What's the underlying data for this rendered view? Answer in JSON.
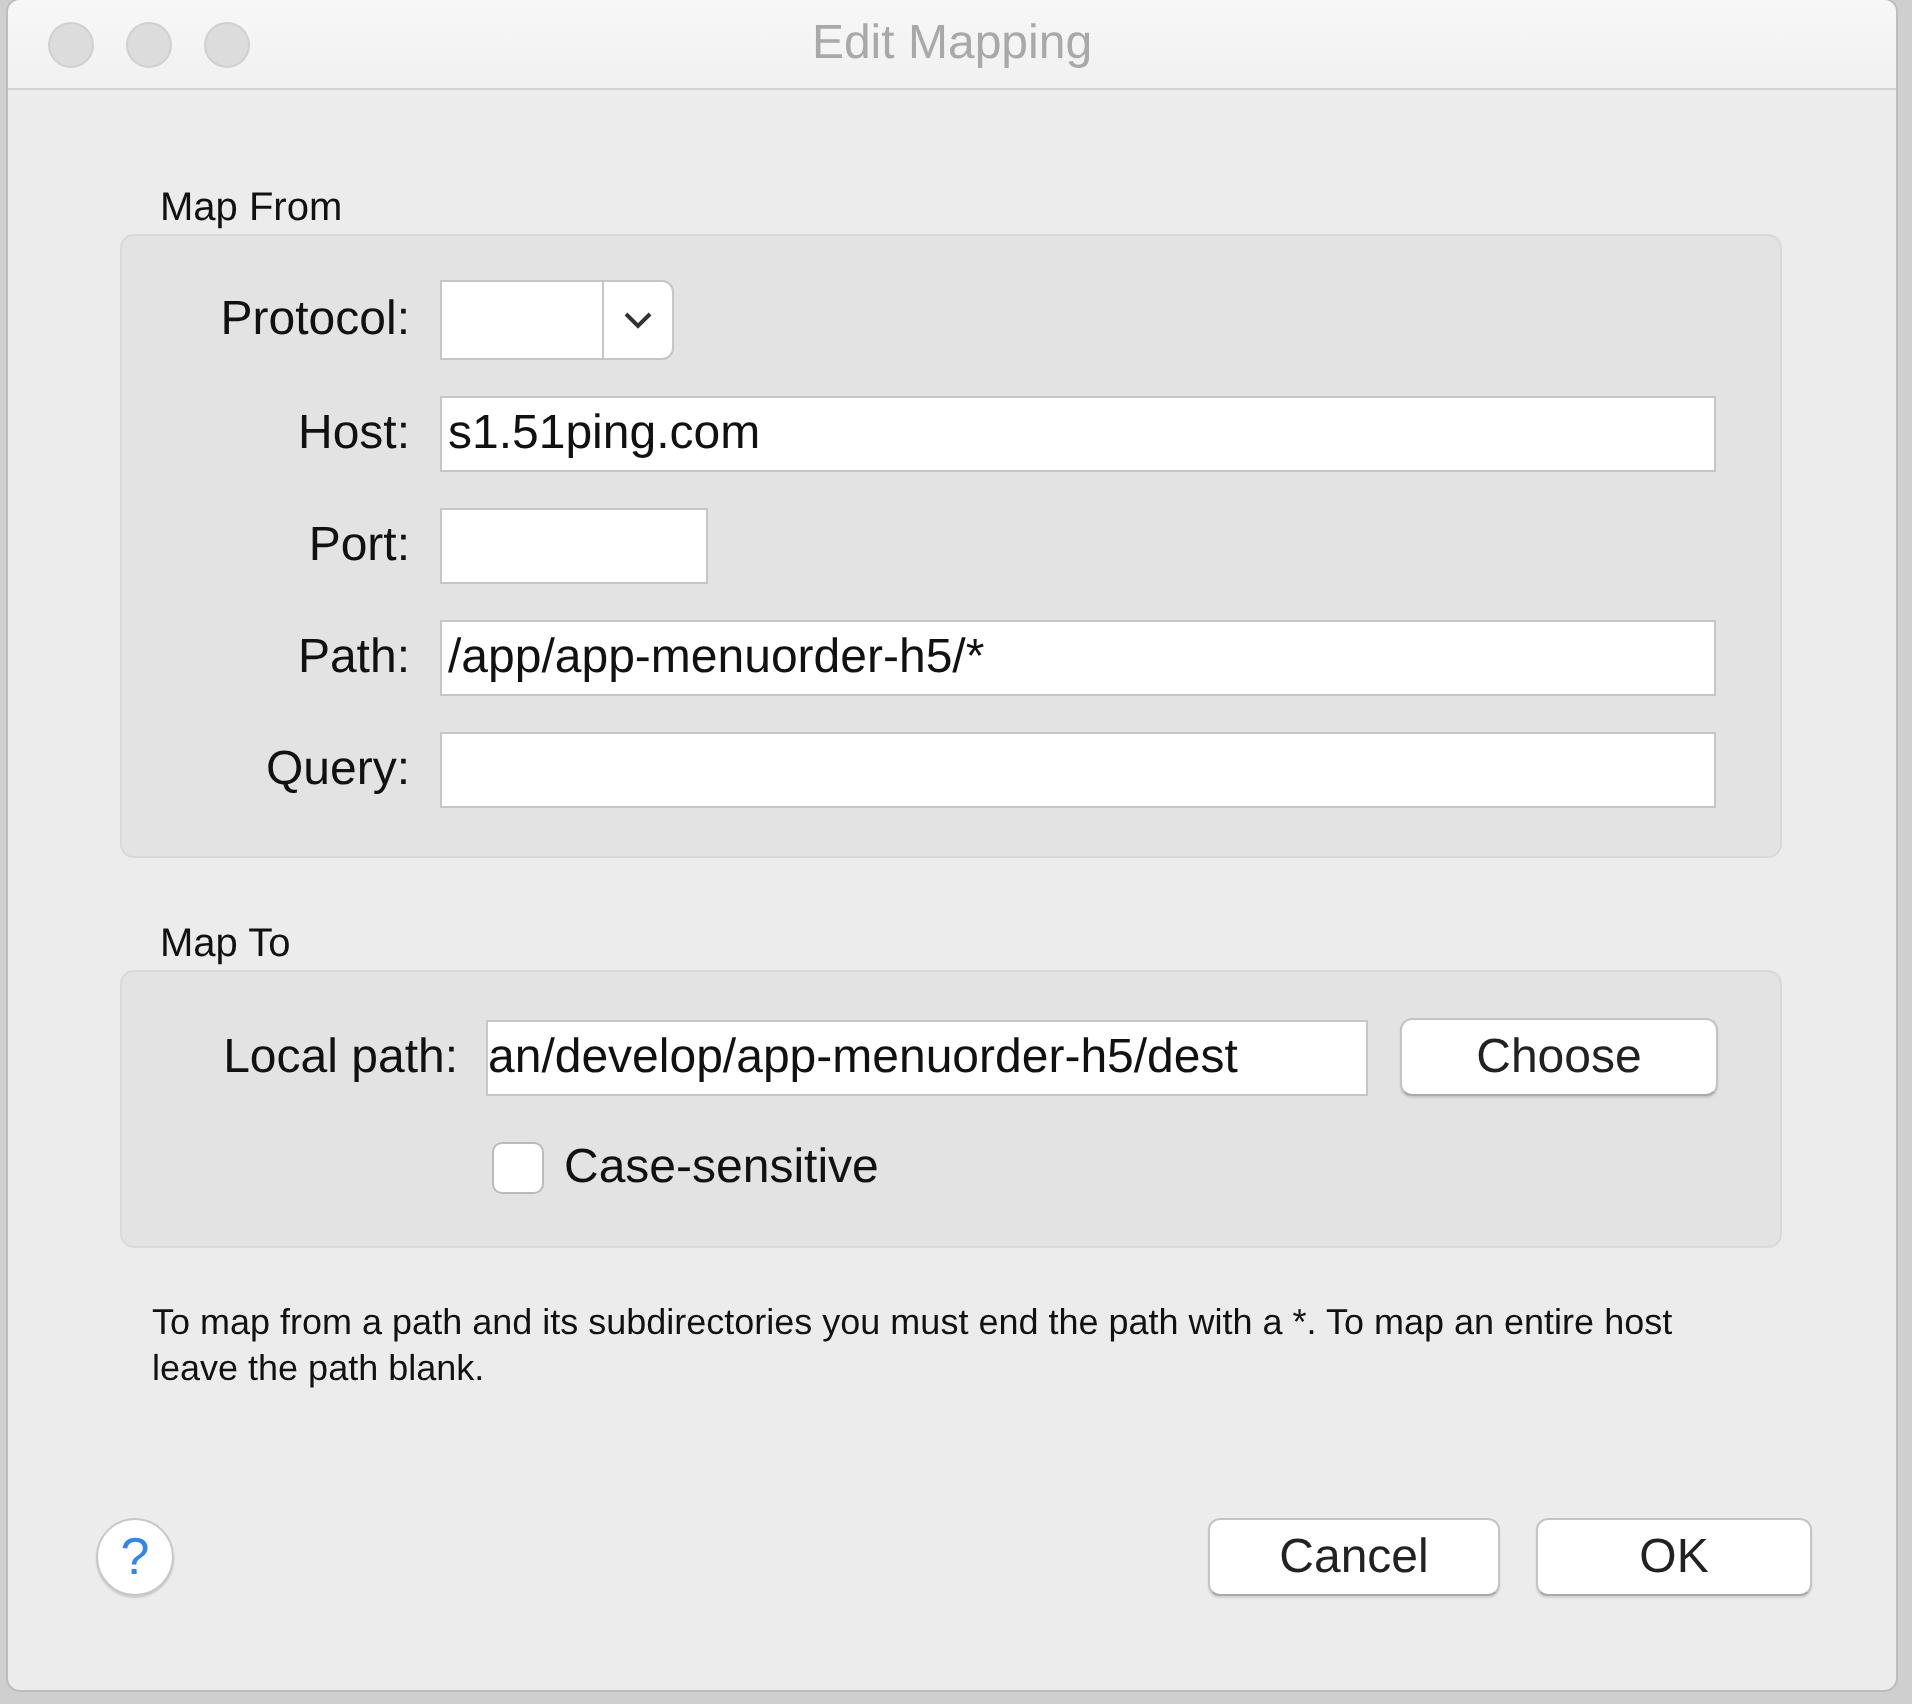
{
  "window": {
    "title": "Edit Mapping"
  },
  "map_from": {
    "title": "Map From",
    "fields": [
      {
        "label": "Protocol:",
        "kind": "combo"
      },
      {
        "label": "Host:",
        "kind": "text",
        "value": "s1.51ping.com"
      },
      {
        "label": "Port:",
        "kind": "short"
      },
      {
        "label": "Path:",
        "kind": "text",
        "value": "/app/app-menuorder-h5/*"
      },
      {
        "label": "Query:",
        "kind": "text"
      }
    ]
  },
  "map_to": {
    "title": "Map To",
    "local_path": {
      "label": "Local path:",
      "value": "an/develop/app-menuorder-h5/dest"
    },
    "choose_button": "Choose",
    "case_sensitive": {
      "label": "Case-sensitive",
      "checked": false
    }
  },
  "hint": "To map from a path and its subdirectories you must end the path with a *. To map an entire host leave the path blank.",
  "help_button": "?",
  "buttons": [
    {
      "label": "Cancel"
    },
    {
      "label": "OK"
    }
  ]
}
